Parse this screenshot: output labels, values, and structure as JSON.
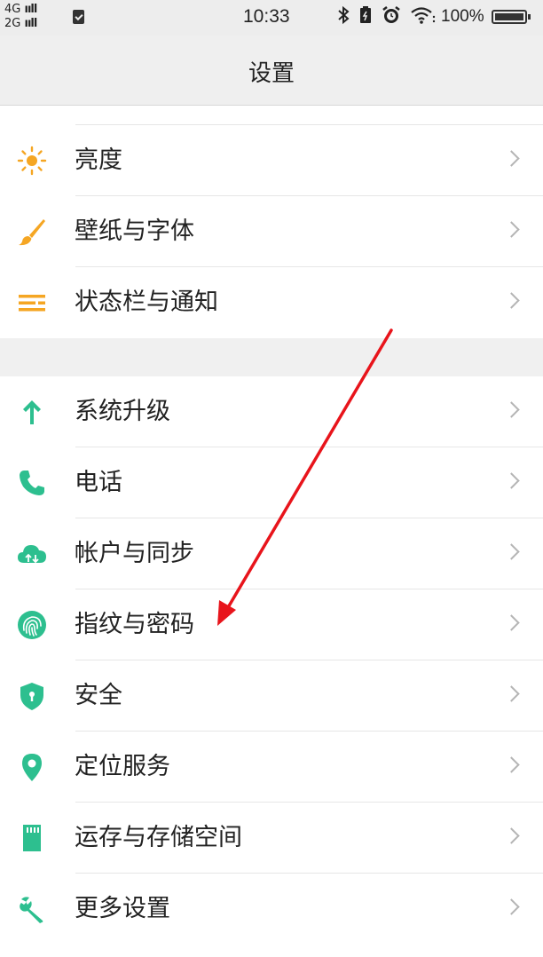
{
  "status_bar": {
    "signal_1": "4G",
    "signal_2": "2G",
    "signal_bars": "ııll",
    "time": "10:33",
    "battery_percent": "100%",
    "icons": [
      "bluetooth-icon",
      "battery-saver-icon",
      "alarm-icon",
      "wifi-icon",
      "battery-icon"
    ]
  },
  "header": {
    "title": "设置"
  },
  "groups": [
    {
      "items": [
        {
          "label": "亮度",
          "icon": "brightness-icon",
          "icon_color": "#f5a623"
        },
        {
          "label": "壁纸与字体",
          "icon": "paintbrush-icon",
          "icon_color": "#f5a623"
        },
        {
          "label": "状态栏与通知",
          "icon": "status-bar-list-icon",
          "icon_color": "#f5a623"
        }
      ]
    },
    {
      "items": [
        {
          "label": "系统升级",
          "icon": "arrow-up-icon",
          "icon_color": "#2dbf8f"
        },
        {
          "label": "电话",
          "icon": "phone-icon",
          "icon_color": "#2dbf8f"
        },
        {
          "label": "帐户与同步",
          "icon": "cloud-sync-icon",
          "icon_color": "#2dbf8f"
        },
        {
          "label": "指纹与密码",
          "icon": "fingerprint-icon",
          "icon_color": "#2dbf8f"
        },
        {
          "label": "安全",
          "icon": "shield-icon",
          "icon_color": "#2dbf8f"
        },
        {
          "label": "定位服务",
          "icon": "location-pin-icon",
          "icon_color": "#2dbf8f"
        },
        {
          "label": "运存与存储空间",
          "icon": "sd-card-icon",
          "icon_color": "#2dbf8f"
        },
        {
          "label": "更多设置",
          "icon": "wrench-icon",
          "icon_color": "#2dbf8f"
        }
      ]
    }
  ],
  "annotation": {
    "arrow_color": "#e8141b",
    "points_to": "指纹与密码"
  },
  "colors": {
    "orange_accent": "#f5a623",
    "green_accent": "#2dbf8f",
    "chevron": "#b5b5b5"
  }
}
